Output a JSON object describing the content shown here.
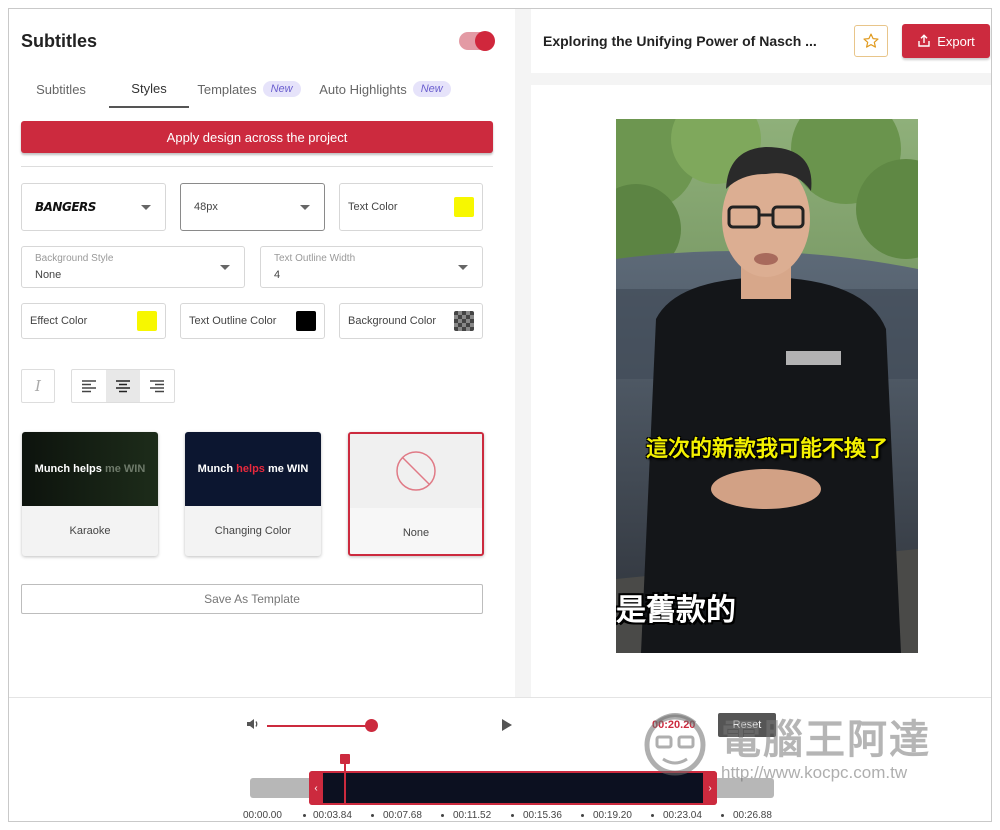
{
  "left_panel": {
    "title": "Subtitles",
    "tabs": [
      {
        "label": "Subtitles",
        "badge": ""
      },
      {
        "label": "Styles",
        "badge": ""
      },
      {
        "label": "Templates",
        "badge": "New"
      },
      {
        "label": "Auto Highlights",
        "badge": "New"
      }
    ],
    "apply_button": "Apply design across the project",
    "font": "BANGERS",
    "font_size": "48px",
    "text_color_label": "Text Color",
    "background_style": {
      "label": "Background Style",
      "value": "None"
    },
    "text_outline_width": {
      "label": "Text Outline Width",
      "value": "4"
    },
    "effect_color_label": "Effect Color",
    "text_outline_color_label": "Text Outline Color",
    "background_color_label": "Background Color",
    "templates": [
      {
        "label": "Karaoke",
        "preview_a": "Munch helps",
        "preview_b": " me WIN"
      },
      {
        "label": "Changing Color",
        "preview_a": "Munch ",
        "preview_hl": "helps",
        "preview_b": " me WIN"
      },
      {
        "label": "None"
      }
    ],
    "save_template": "Save As Template"
  },
  "colors": {
    "accent": "#cc2a3e",
    "text_color": "#f7f700",
    "effect_color": "#f7f700",
    "outline_color": "#000000"
  },
  "topbar": {
    "project_title": "Exploring the Unifying Power of Nasch ...",
    "export_label": "Export"
  },
  "preview": {
    "subtitle_line": "這次的新款我可能不換了",
    "subtitle_big": "是舊款的"
  },
  "timeline": {
    "current_time": "00:20.20",
    "reset_label": "Reset",
    "ticks": [
      "00:00.00",
      "00:03.84",
      "00:07.68",
      "00:11.52",
      "00:15.36",
      "00:19.20",
      "00:23.04",
      "00:26.88"
    ]
  },
  "watermark": {
    "text": "電腦王阿達",
    "url": "http://www.kocpc.com.tw"
  }
}
